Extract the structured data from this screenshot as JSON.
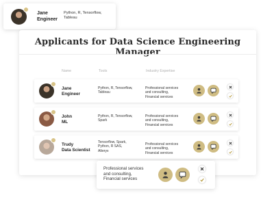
{
  "title": "Applicants for Data Science Engineering Manager",
  "headers": {
    "name": "Name",
    "tools": "Tools",
    "industry": "Industry Expertise"
  },
  "rows": [
    {
      "name1": "Jane",
      "name2": "Engineer",
      "tools1": "Python, R, Tensorflow,",
      "tools2": "Tableau",
      "tools3": "",
      "ind1": "Professional services",
      "ind2": "and consulting,",
      "ind3": "Financial services"
    },
    {
      "name1": "John",
      "name2": "ML",
      "tools1": "Python, R, Tensorflow,",
      "tools2": "Spark",
      "tools3": "",
      "ind1": "Professional services",
      "ind2": "and consulting,",
      "ind3": "Financial services"
    },
    {
      "name1": "Trudy",
      "name2": "Data Scientist",
      "tools1": "Tensorflow, Spark,",
      "tools2": "Python, R SAS,",
      "tools3": "Alteryx",
      "ind1": "Professional services",
      "ind2": "and consulting,",
      "ind3": "Financial services"
    }
  ],
  "popup_top": {
    "name1": "Jane",
    "name2": "Engineer",
    "tools1": "Python, R, Tensorflow,",
    "tools2": "Tableau"
  },
  "popup_bottom": {
    "ind1": "Professional services",
    "ind2": "and consulting,",
    "ind3": "Financial services"
  },
  "colors": {
    "accent": "#cfbc83",
    "badge": "#d8c387",
    "avatar_jane": "#3b3329",
    "avatar_john": "#8a5a44",
    "avatar_trudy": "#b8a89a"
  },
  "icons": {
    "profile": "person-icon",
    "message": "chat-icon",
    "reject": "close-icon",
    "accept": "check-icon"
  }
}
